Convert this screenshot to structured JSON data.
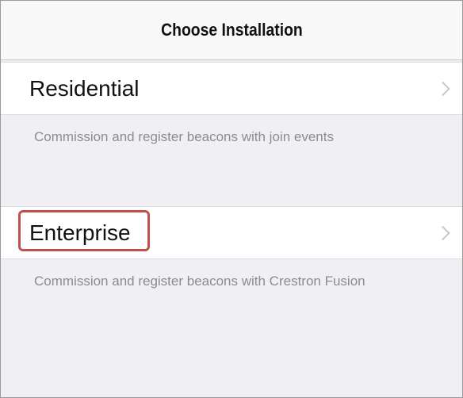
{
  "navbar": {
    "title": "Choose Installation"
  },
  "options": [
    {
      "label": "Residential",
      "description": "Commission and register beacons with join events",
      "chevron_icon": "chevron-right-icon"
    },
    {
      "label": "Enterprise",
      "description": "Commission and register beacons with Crestron Fusion",
      "chevron_icon": "chevron-right-icon",
      "highlighted": true
    }
  ],
  "colors": {
    "background": "#efeff4",
    "row_background": "#ffffff",
    "highlight_border": "#c0504d",
    "description_text": "#8b8b90",
    "chevron": "#c7c7cc"
  }
}
